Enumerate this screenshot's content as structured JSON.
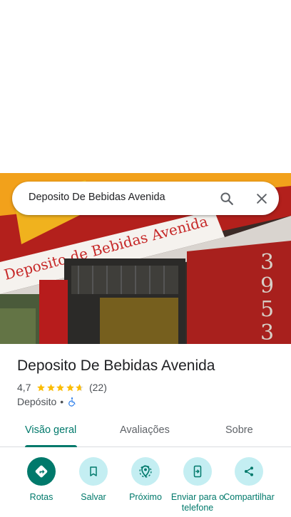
{
  "search": {
    "query": "Deposito De Bebidas Avenida"
  },
  "photo": {
    "sign_text": "Deposito de Bebidas Avenida",
    "number_text": "3953"
  },
  "place": {
    "name": "Deposito De Bebidas Avenida",
    "rating": "4,7",
    "stars_filled": 4.7,
    "review_count": "(22)",
    "category": "Depósito",
    "separator": "•"
  },
  "tabs": [
    {
      "label": "Visão geral",
      "active": true
    },
    {
      "label": "Avaliações",
      "active": false
    },
    {
      "label": "Sobre",
      "active": false
    }
  ],
  "actions": [
    {
      "label": "Rotas",
      "icon": "directions-icon"
    },
    {
      "label": "Salvar",
      "icon": "bookmark-icon"
    },
    {
      "label": "Próximo",
      "icon": "nearby-icon"
    },
    {
      "label": "Enviar para o telefone",
      "icon": "send-to-phone-icon"
    },
    {
      "label": "Compartilhar",
      "icon": "share-icon"
    }
  ],
  "colors": {
    "accent": "#00796b",
    "accent_light": "#c4eef2",
    "star": "#fbbc04",
    "icon_gray": "#5f6368"
  }
}
